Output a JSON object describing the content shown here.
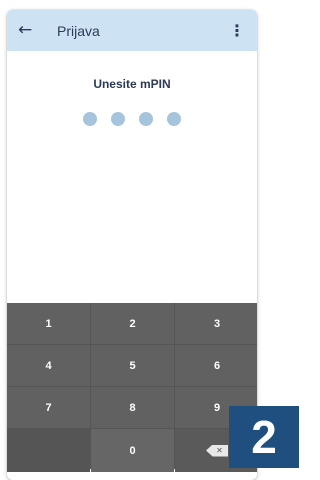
{
  "appbar": {
    "back_icon": "arrow-left",
    "title": "Prijava",
    "menu_icon": "more-vertical"
  },
  "pin": {
    "prompt": "Unesite mPIN",
    "dots_filled": 0,
    "dots_total": 4
  },
  "keypad": {
    "keys": [
      "1",
      "2",
      "3",
      "4",
      "5",
      "6",
      "7",
      "8",
      "9",
      "",
      "0",
      "backspace"
    ]
  },
  "badge": {
    "text": "2"
  },
  "colors": {
    "appbar_bg": "#cde3f4",
    "text_primary": "#2c3a55",
    "dot": "#a6c5dc",
    "keypad_bg": "#616161",
    "badge_bg": "#1e4f7e"
  }
}
